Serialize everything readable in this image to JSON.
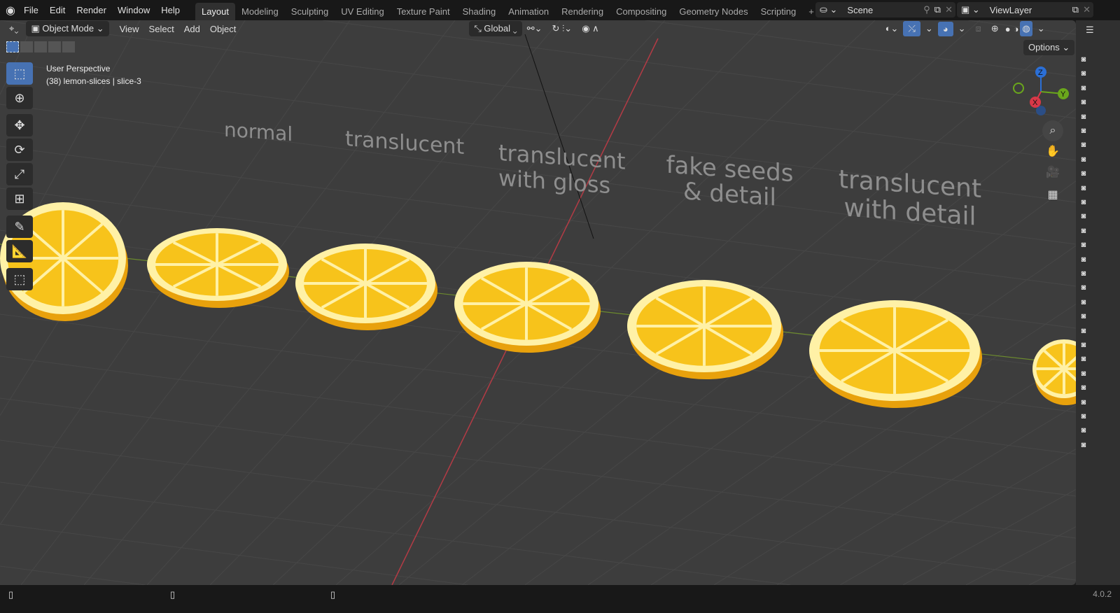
{
  "menu": [
    "File",
    "Edit",
    "Render",
    "Window",
    "Help"
  ],
  "workspaces": [
    "Layout",
    "Modeling",
    "Sculpting",
    "UV Editing",
    "Texture Paint",
    "Shading",
    "Animation",
    "Rendering",
    "Compositing",
    "Geometry Nodes",
    "Scripting"
  ],
  "scene": "Scene",
  "view_layer": "ViewLayer",
  "header": {
    "mode": "Object Mode",
    "menus": [
      "View",
      "Select",
      "Add",
      "Object"
    ],
    "orientation": "Global",
    "options": "Options"
  },
  "overlay": {
    "line1": "User Perspective",
    "line2": "(38) lemon-slices | slice-3"
  },
  "labels": [
    "normal",
    "translucent",
    "translucent with gloss",
    "fake seeds & detail",
    "translucent with detail"
  ],
  "axes": {
    "x": "X",
    "y": "Y",
    "z": "Z"
  },
  "version": "4.0.2",
  "colors": {
    "accent": "#4772b3",
    "lemon": "#f7c31b",
    "lemon_light": "#fff1a6"
  }
}
